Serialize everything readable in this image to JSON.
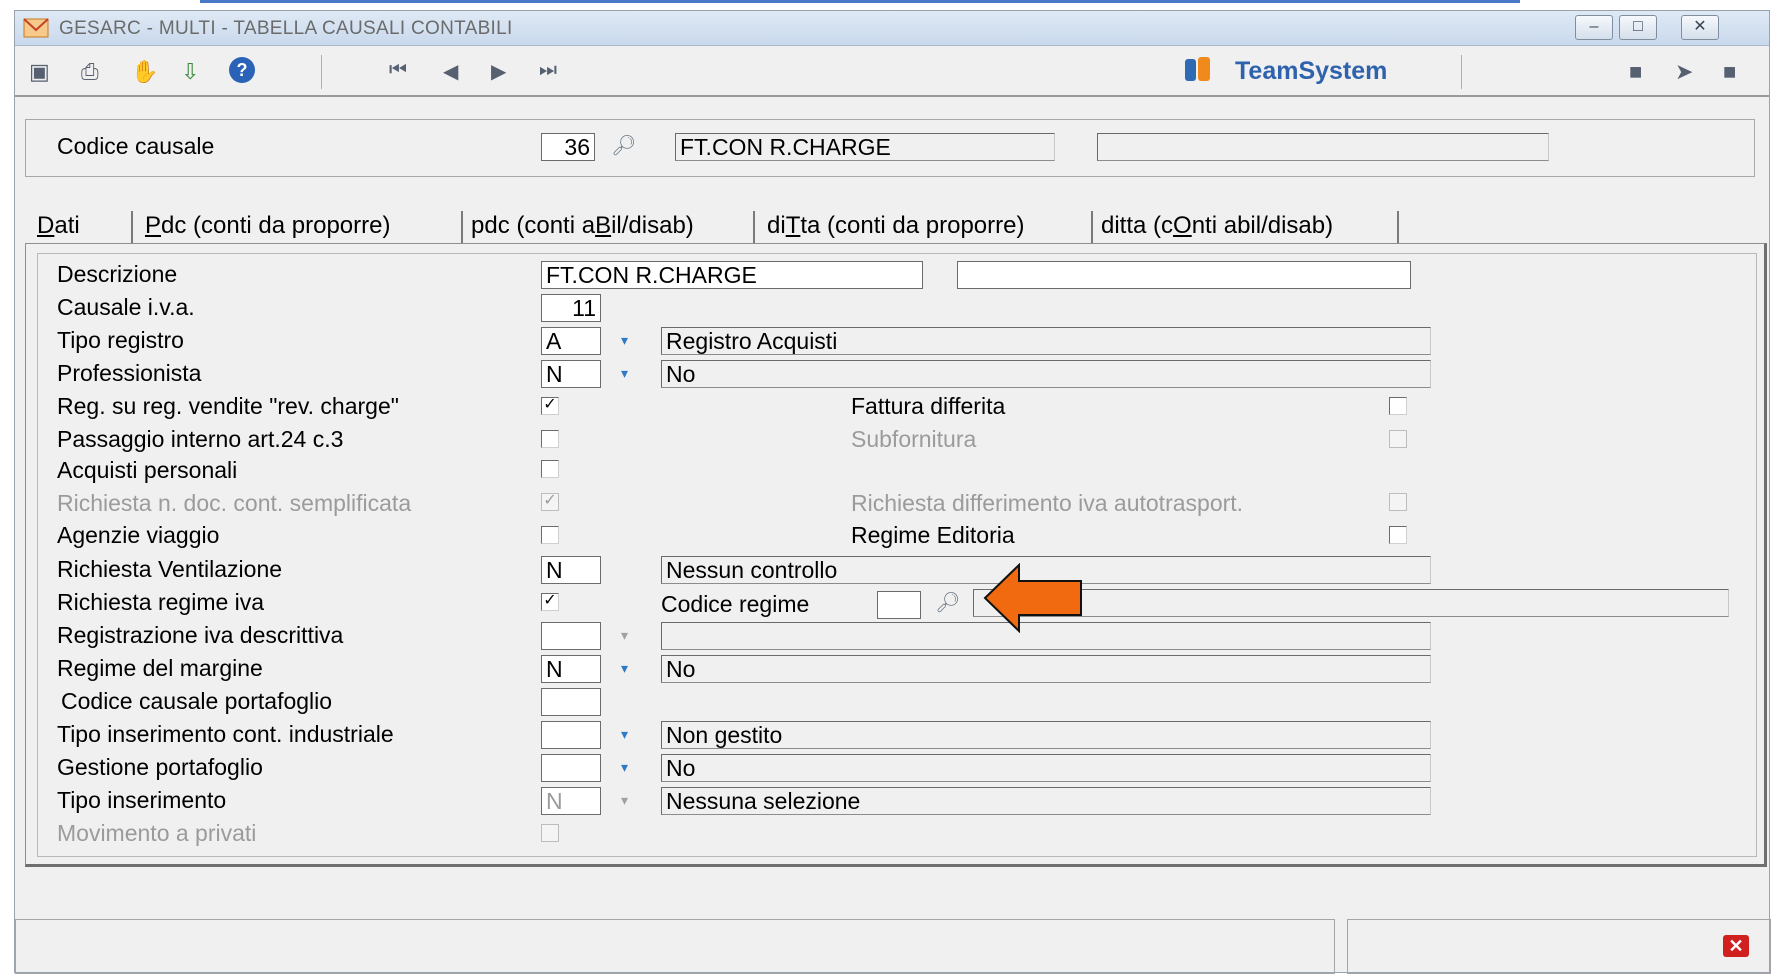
{
  "window": {
    "title": "GESARC  - MULTI -  TABELLA CAUSALI CONTABILI",
    "buttons": [
      "minimize",
      "maximize",
      "close"
    ]
  },
  "toolbar": {
    "left_icons": [
      "record-icon",
      "print-icon",
      "hand-icon",
      "export-icon",
      "help-icon"
    ],
    "nav_icons": [
      "first-record-icon",
      "previous-record-icon",
      "next-record-icon",
      "last-record-icon"
    ],
    "brand": "TeamSystem",
    "right_icons": [
      "folder-icon",
      "forward-icon",
      "save-icon"
    ]
  },
  "header": {
    "code_label": "Codice causale",
    "code_value": "36",
    "code_description": "FT.CON R.CHARGE",
    "extra_value": ""
  },
  "tabs": [
    {
      "pre": "",
      "key": "D",
      "post": "ati",
      "active": true
    },
    {
      "pre": "",
      "key": "P",
      "post": "dc (conti da proporre)",
      "active": false
    },
    {
      "pre": "pdc (conti a",
      "key": "B",
      "post": "il/disab)",
      "active": false
    },
    {
      "pre": "di",
      "key": "T",
      "post": "ta (conti da proporre)",
      "active": false
    },
    {
      "pre": "ditta (c",
      "key": "O",
      "post": "nti abil/disab)",
      "active": false
    }
  ],
  "form": {
    "descrizione": {
      "label": "Descrizione",
      "value": "FT.CON R.CHARGE",
      "extra": ""
    },
    "causale_iva": {
      "label": "Causale i.v.a.",
      "value": "11"
    },
    "tipo_registro": {
      "label": "Tipo registro",
      "code": "A",
      "text": "Registro Acquisti"
    },
    "professionista": {
      "label": "Professionista",
      "code": "N",
      "text": "No"
    },
    "reg_vendite": {
      "label": "Reg. su reg. vendite \"rev. charge\"",
      "checked": true
    },
    "fattura_differita": {
      "label": "Fattura differita",
      "checked": false
    },
    "passaggio_interno": {
      "label": "Passaggio interno art.24 c.3",
      "checked": false
    },
    "subfornitura": {
      "label": "Subfornitura",
      "checked": false,
      "disabled": true
    },
    "acquisti_personali": {
      "label": "Acquisti personali",
      "checked": false
    },
    "richiesta_doc": {
      "label": "Richiesta n. doc. cont. semplificata",
      "checked": true,
      "disabled": true
    },
    "differimento_iva": {
      "label": "Richiesta differimento iva autotrasport.",
      "checked": false,
      "disabled": true
    },
    "agenzie_viaggio": {
      "label": "Agenzie viaggio",
      "checked": false
    },
    "regime_editoria": {
      "label": "Regime Editoria",
      "checked": false
    },
    "ventilazione": {
      "label": "Richiesta Ventilazione",
      "code": "N",
      "text": "Nessun controllo"
    },
    "regime_iva": {
      "label": "Richiesta regime iva",
      "checked": true
    },
    "codice_regime": {
      "label": "Codice regime",
      "value": "",
      "text": ""
    },
    "iva_descrittiva": {
      "label": "Registrazione iva descrittiva",
      "code": "",
      "text": ""
    },
    "regime_margine": {
      "label": "Regime del margine",
      "code": "N",
      "text": "No"
    },
    "causale_portafoglio": {
      "label": "Codice causale portafoglio",
      "value": ""
    },
    "cont_industriale": {
      "label": "Tipo inserimento cont. industriale",
      "code": "",
      "text": "Non gestito"
    },
    "gestione_portafoglio": {
      "label": "Gestione portafoglio",
      "code": "",
      "text": "No"
    },
    "tipo_inserimento": {
      "label": "Tipo inserimento",
      "code": "N",
      "text": "Nessuna selezione"
    },
    "movimento_privati": {
      "label": "Movimento a privati",
      "checked": false,
      "disabled": true
    }
  },
  "annotation": {
    "color": "#f26a0f"
  },
  "status_bar": {
    "left": "",
    "right": ""
  }
}
